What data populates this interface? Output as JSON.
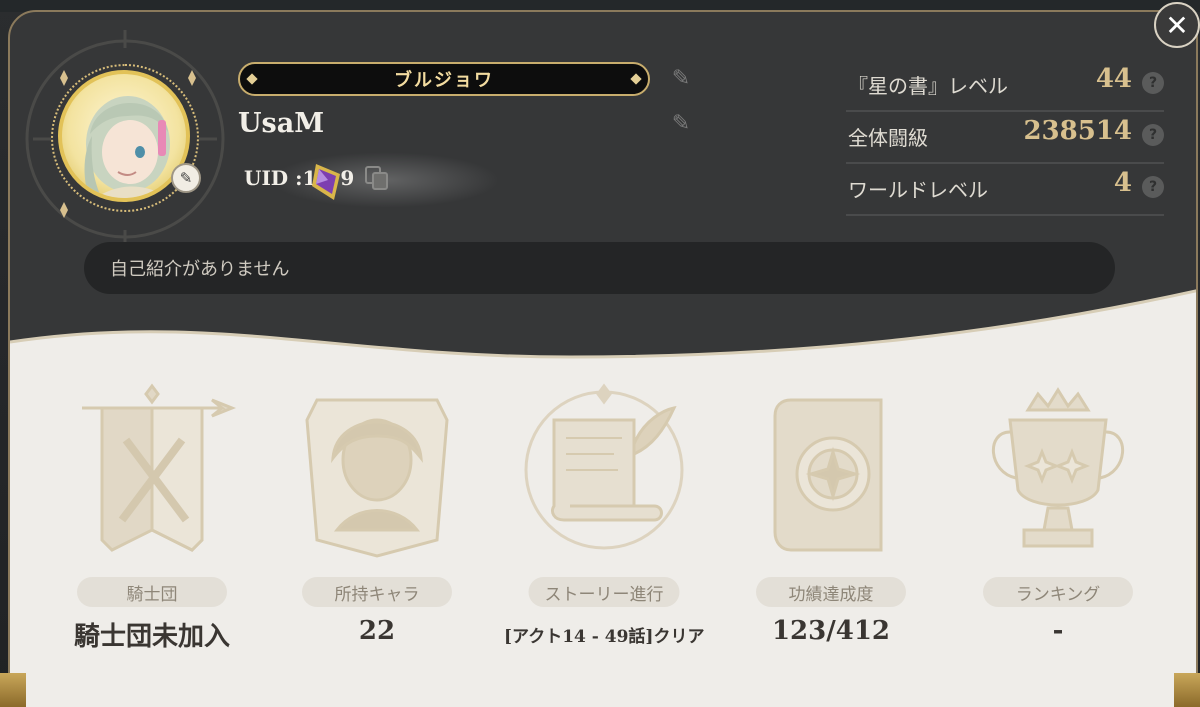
{
  "profile": {
    "title_badge": "ブルジョワ",
    "username": "UsaM",
    "uid": "UID :1",
    "uid_suffix": "9",
    "intro_text": "自己紹介がありません"
  },
  "stats": [
    {
      "label": "『星の書』レベル",
      "value": "44",
      "help": "?"
    },
    {
      "label": "全体闘級",
      "value": "238514",
      "help": "?"
    },
    {
      "label": "ワールドレベル",
      "value": "4",
      "help": "?"
    }
  ],
  "info": [
    {
      "label": "騎士団",
      "value": "騎士団未加入",
      "icon": "knights-banner-icon"
    },
    {
      "label": "所持キャラ",
      "value": "22",
      "icon": "character-portrait-icon"
    },
    {
      "label": "ストーリー進行",
      "value": "[アクト14 - 49話]クリア",
      "icon": "story-scroll-icon"
    },
    {
      "label": "功績達成度",
      "value": "123/412",
      "icon": "achievement-book-icon"
    },
    {
      "label": "ランキング",
      "value": "-",
      "icon": "ranking-trophy-icon"
    }
  ],
  "controls": {
    "close": "✕",
    "edit": "✎"
  },
  "colors": {
    "panel_dark": "#363738",
    "panel_light": "#efede9",
    "gold": "#d8c08e",
    "title_text": "#f3dca0"
  }
}
